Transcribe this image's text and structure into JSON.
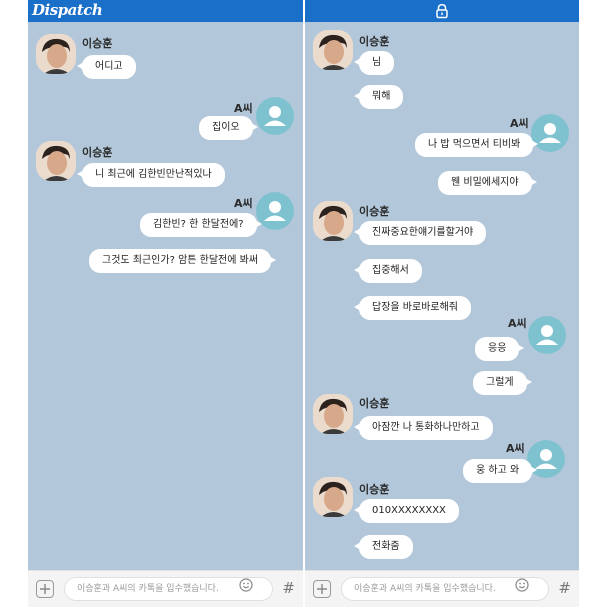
{
  "brand": {
    "logo": "Dispatch",
    "topbar_color": "#1a6fc9",
    "chat_bg": "#b2c7da"
  },
  "icons": [
    "lock-icon",
    "person-icon",
    "plus-icon",
    "emoji-icon",
    "hash-icon"
  ],
  "left": {
    "sender1": "이승훈",
    "sender2": "A씨",
    "m1": "어디고",
    "m2": "집이오",
    "m3": "니 최근에 김한빈만난적있나",
    "m4": "김한빈? 한 한달전에?",
    "m5": "그것도 최근인가? 암튼 한달전에 봐써"
  },
  "right": {
    "sender1": "이승훈",
    "sender2": "A씨",
    "m1": "님",
    "m2": "뭐해",
    "m3": "나 밥 먹으면서 티비봐",
    "m4": "웬 비밀에세지야",
    "m5": "진짜중요한얘기를할거야",
    "m6": "집중해서",
    "m7": "답장을 바로바로해줘",
    "m8": "응응",
    "m9": "그럴게",
    "m10": "아잠깐 나 통화하나만하고",
    "m11": "웅 하고 와",
    "m12": "010XXXXXXXX",
    "m13": "전화줌"
  },
  "input": {
    "placeholder": "이승훈과 A씨의 카톡을 입수했습니다.",
    "hash": "#"
  }
}
